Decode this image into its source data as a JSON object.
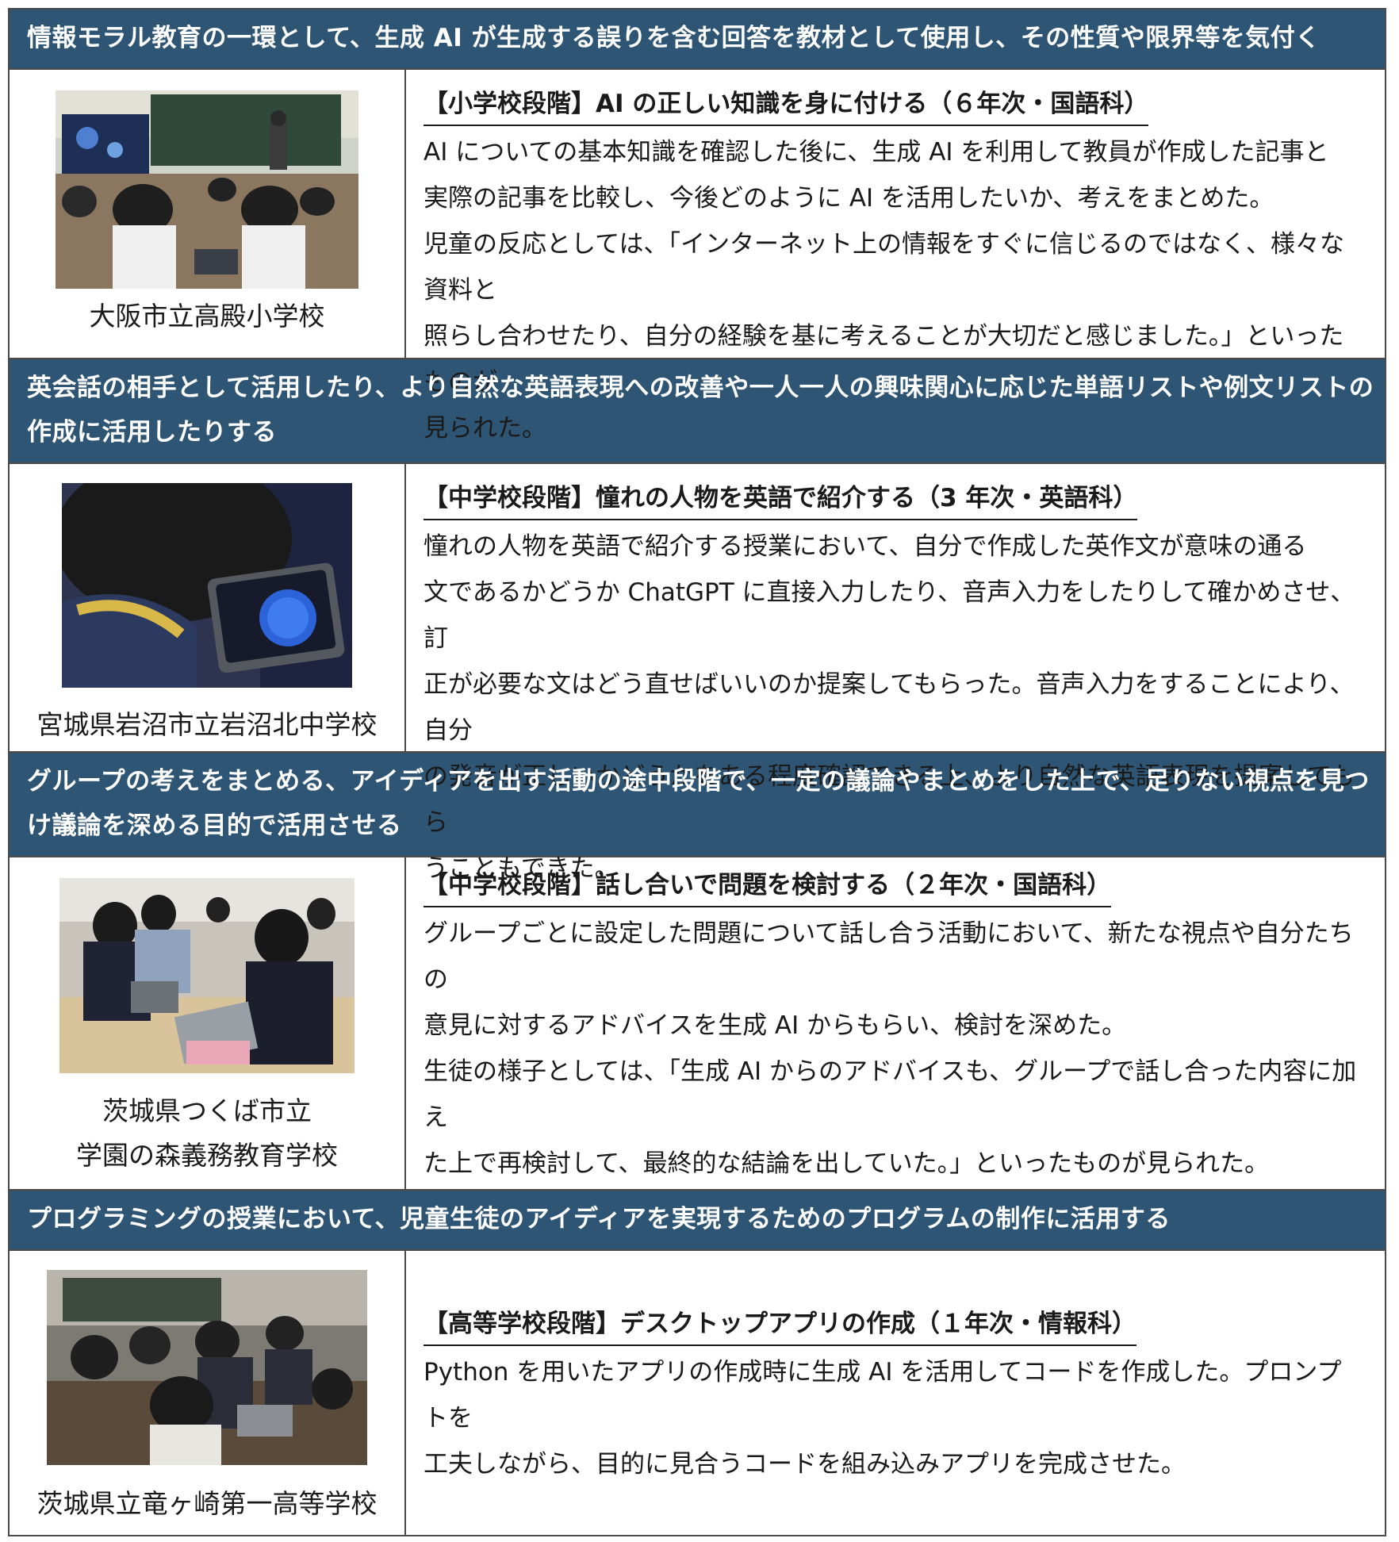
{
  "sections": [
    {
      "header": "情報モラル教育の一環として、生成 AI が生成する誤りを含む回答を教材として使用し、その性質や限界等を気付く",
      "title": "【小学校段階】AI の正しい知識を身に付ける（６年次・国語科）",
      "body": [
        "AI についての基本知識を確認した後に、生成 AI を利用して教員が作成した記事と",
        "実際の記事を比較し、今後どのように AI を活用したいか、考えをまとめた。",
        "児童の反応としては、「インターネット上の情報をすぐに信じるのではなく、様々な資料と",
        "照らし合わせたり、自分の経験を基に考えることが大切だと感じました。」といったものが",
        "見られた。"
      ],
      "school": [
        "大阪市立高殿小学校"
      ]
    },
    {
      "header": "英会話の相手として活用したり、より自然な英語表現への改善や一人一人の興味関心に応じた単語リストや例文リストの作成に活用したりする",
      "title": "【中学校段階】憧れの人物を英語で紹介する（3 年次・英語科）",
      "body": [
        "憧れの人物を英語で紹介する授業において、自分で作成した英作文が意味の通る",
        "文であるかどうか ChatGPT に直接入力したり、音声入力をしたりして確かめさせ、訂",
        "正が必要な文はどう直せばいいのか提案してもらった。音声入力をすることにより、自分",
        "の発音が正しいかどうかをある程度確認できる上、より自然な英語表現を提案してもら",
        "うこともできた。"
      ],
      "school": [
        "宮城県岩沼市立岩沼北中学校"
      ]
    },
    {
      "header": "グループの考えをまとめる、アイディアを出す活動の途中段階で、一定の議論やまとめをした上で、足りない視点を見つけ議論を深める目的で活用させる",
      "title": "【中学校段階】話し合いで問題を検討する（２年次・国語科）",
      "body": [
        "グループごとに設定した問題について話し合う活動において、新たな視点や自分たちの",
        "意見に対するアドバイスを生成 AI からもらい、検討を深めた。",
        "生徒の様子としては、「生成 AI からのアドバイスも、グループで話し合った内容に加え",
        "た上で再検討して、最終的な結論を出していた。」といったものが見られた。"
      ],
      "school": [
        "茨城県つくば市立",
        "学園の森義務教育学校"
      ]
    },
    {
      "header": "プログラミングの授業において、児童生徒のアイディアを実現するためのプログラムの制作に活用する",
      "title": "【高等学校段階】デスクトップアプリの作成（１年次・情報科）",
      "body": [
        "Python を用いたアプリの作成時に生成 AI を活用してコードを作成した。プロンプトを",
        "工夫しながら、目的に見合うコードを組み込みアプリを完成させた。"
      ],
      "school": [
        "茨城県立竜ヶ崎第一高等学校"
      ]
    }
  ]
}
